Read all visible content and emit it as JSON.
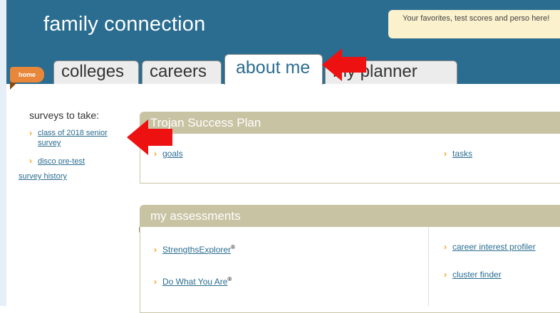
{
  "header": {
    "logo": "family connection",
    "tooltip": "Your favorites, test scores and perso here!",
    "home_label": "home"
  },
  "tabs": [
    {
      "label": "colleges"
    },
    {
      "label": "careers"
    },
    {
      "label": "about me",
      "active": true
    },
    {
      "label": "my planner"
    }
  ],
  "sidebar": {
    "title": "surveys to take:",
    "items": [
      {
        "label": "class of 2018 senior survey"
      },
      {
        "label": "disco pre-test"
      }
    ],
    "history": "survey history"
  },
  "success_plan": {
    "title": "Trojan Success Plan",
    "left_link": "goals",
    "right_link": "tasks"
  },
  "assessments": {
    "title": "my assessments",
    "left": [
      {
        "label": "StrengthsExplorer",
        "mark": "®"
      },
      {
        "label": "Do What You Are",
        "mark": "®"
      }
    ],
    "right": [
      {
        "label": "career interest profiler"
      },
      {
        "label": "cluster finder"
      }
    ]
  },
  "colors": {
    "header_blue": "#2a6d90",
    "panel_tan": "#c8c3a3",
    "home_orange": "#e8873a",
    "chevron": "#f0a420",
    "annotation_red": "#ee1111"
  },
  "icons": [
    "chevron-right-icon",
    "red-arrow-annotation"
  ]
}
